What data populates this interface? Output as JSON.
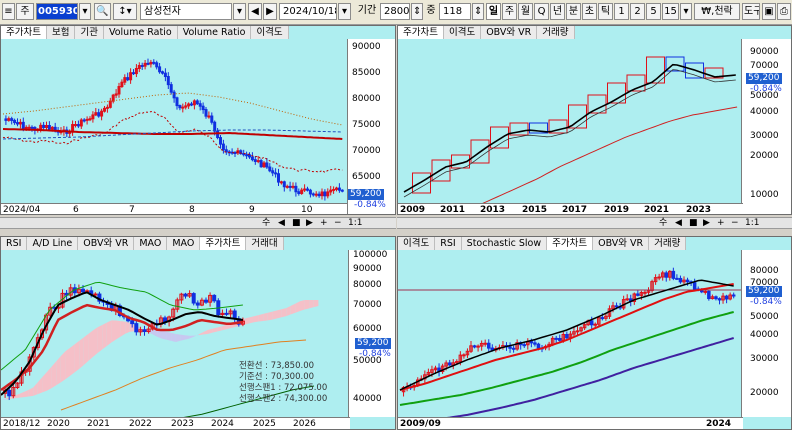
{
  "toolbar": {
    "mode": "주",
    "code": "005930",
    "name": "삼성전자",
    "date": "2024/10/18",
    "period_label": "기간",
    "period_value": "2800",
    "zoom_label": "중",
    "zoom_value": "118",
    "freq": [
      "일",
      "주",
      "월",
      "Q",
      "년",
      "분",
      "초",
      "틱",
      "1",
      "2",
      "5",
      "15"
    ],
    "active_freq": "일",
    "won_label": "₩,천락",
    "tools_label": "도구"
  },
  "panes": {
    "tl": {
      "tabs": [
        "주가차트",
        "보험",
        "기관",
        "Volume Ratio",
        "Volume Ratio",
        "이격도"
      ],
      "yticks": [
        "90000",
        "85000",
        "80000",
        "75000",
        "70000",
        "65000",
        "60000"
      ],
      "xticks": [
        "2024/04",
        "6",
        "7",
        "8",
        "9",
        "10"
      ],
      "price": "59,200",
      "change": "-0.84%"
    },
    "tr": {
      "tabs": [
        "주가차트",
        "이격도",
        "OBV와 VR",
        "거래량"
      ],
      "yticks": [
        "90000",
        "70000",
        "60000",
        "50000",
        "40000",
        "30000",
        "20000",
        "10000"
      ],
      "xticks": [
        "2009",
        "2011",
        "2013",
        "2015",
        "2017",
        "2019",
        "2021",
        "2023"
      ],
      "price": "59,200",
      "change": "-0.84%"
    },
    "bl": {
      "tabs": [
        "RSI",
        "A/D Line",
        "OBV와 VR",
        "MAO",
        "MAO",
        "주가차트",
        "거래대"
      ],
      "yticks": [
        "100000",
        "90000",
        "80000",
        "70000",
        "60000",
        "50000",
        "40000"
      ],
      "xticks": [
        "2018/12",
        "2020",
        "2021",
        "2022",
        "2023",
        "2024",
        "2025",
        "2026"
      ],
      "price": "59,200",
      "change": "-0.84%",
      "ichimoku": [
        {
          "name": "전환선",
          "value": "73,850.00"
        },
        {
          "name": "기준선",
          "value": "70,300.00"
        },
        {
          "name": "선행스팬1",
          "value": "72,075.00"
        },
        {
          "name": "선행스팬2",
          "value": "74,300.00"
        }
      ]
    },
    "br": {
      "tabs": [
        "이격도",
        "RSI",
        "Stochastic Slow",
        "주가차트",
        "OBV와 VR",
        "거래량"
      ],
      "yticks": [
        "80000",
        "70000",
        "60000",
        "50000",
        "40000",
        "30000",
        "20000"
      ],
      "xticks": [
        "2009/09",
        "2024"
      ],
      "price": "59,200",
      "change": "-0.84%"
    }
  },
  "controls": {
    "left": [
      "수",
      "◀",
      "■",
      "▶",
      "+",
      "−",
      "1:1"
    ],
    "right": [
      "수",
      "◀",
      "■",
      "▶",
      "+",
      "−",
      "1:1"
    ]
  },
  "colors": {
    "up": "#e0101a",
    "down": "#1030e0",
    "bg": "#aeeef0"
  }
}
